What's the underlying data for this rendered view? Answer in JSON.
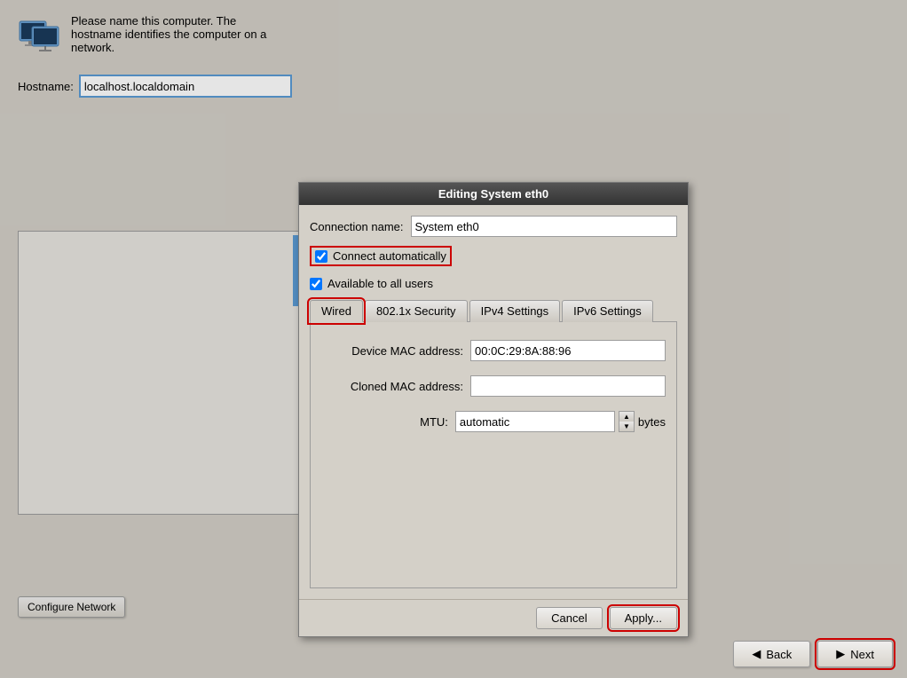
{
  "header": {
    "description_line1": "Please name this computer.  The",
    "description_line2": "hostname identifies the computer on a",
    "description_line3": "network.",
    "hostname_label": "Hostname:",
    "hostname_value": "localhost.localdomain"
  },
  "configure_network_btn": "Configure Network",
  "bottom_nav": {
    "back_label": "Back",
    "next_label": "Next"
  },
  "dialog": {
    "title": "Editing System eth0",
    "connection_name_label": "Connection name:",
    "connection_name_value": "System eth0",
    "connect_automatically_label": "Connect automatically",
    "available_to_all_label": "Available to all users",
    "tabs": [
      {
        "label": "Wired",
        "active": true
      },
      {
        "label": "802.1x Security",
        "active": false
      },
      {
        "label": "IPv4 Settings",
        "active": false
      },
      {
        "label": "IPv6 Settings",
        "active": false
      }
    ],
    "device_mac_label": "Device MAC address:",
    "device_mac_value": "00:0C:29:8A:88:96",
    "cloned_mac_label": "Cloned MAC address:",
    "cloned_mac_value": "",
    "mtu_label": "MTU:",
    "mtu_value": "automatic",
    "mtu_unit": "bytes",
    "cancel_btn": "Cancel",
    "apply_btn": "Apply...",
    "close_icon": "✕"
  }
}
